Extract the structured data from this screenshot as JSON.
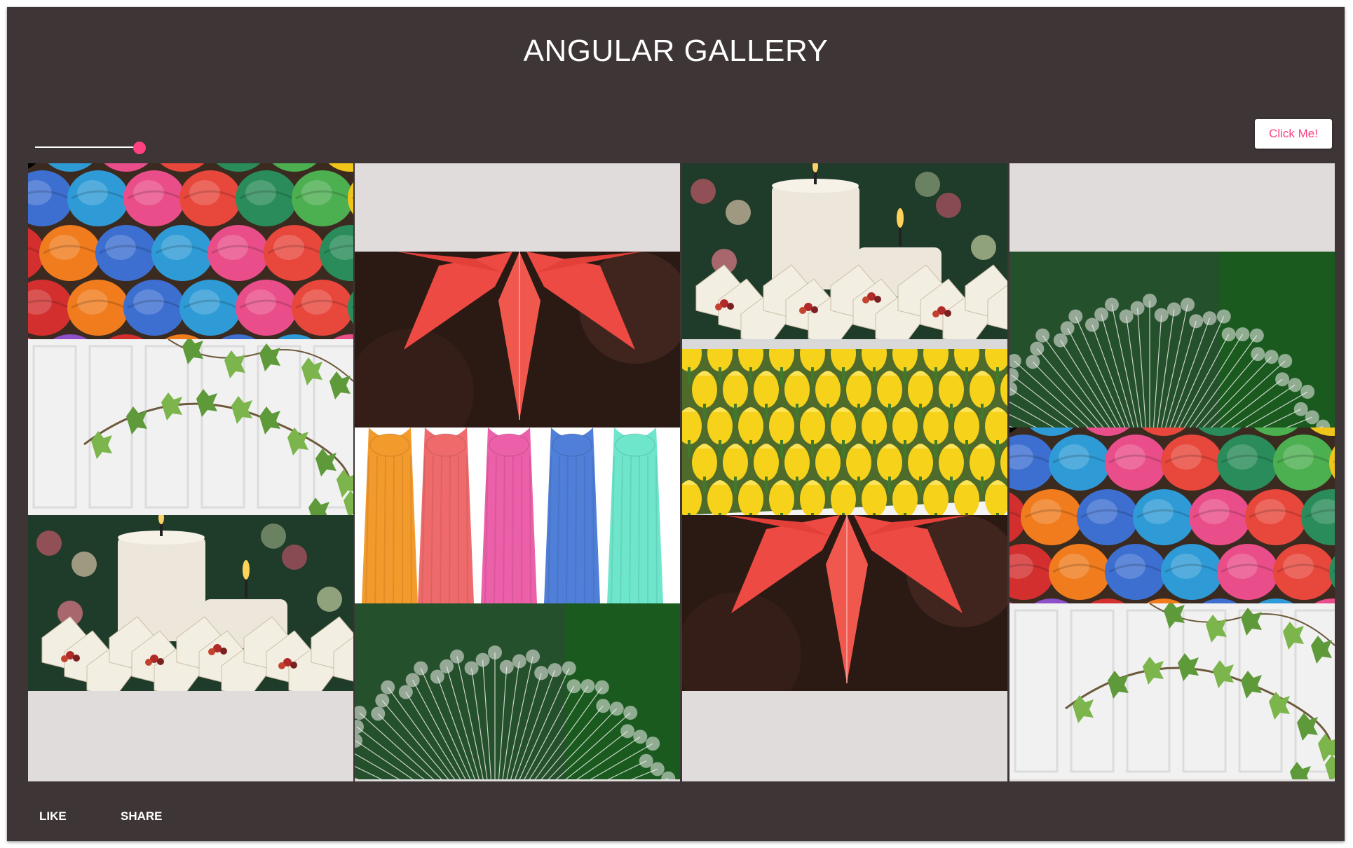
{
  "header": {
    "title": "ANGULAR GALLERY"
  },
  "controls": {
    "slider_value_percent": 100,
    "click_button_label": "Click Me!"
  },
  "colors": {
    "card_bg": "#3d3536",
    "accent": "#ff4081",
    "grid_bg": "#e0dcdc"
  },
  "gallery": {
    "columns": [
      {
        "tiles": [
          "yarn",
          "ivy",
          "candles"
        ]
      },
      {
        "tiles": [
          "red-leaf",
          "scarves",
          "dandelion"
        ]
      },
      {
        "tiles": [
          "candles",
          "yellow-tulips",
          "red-leaf"
        ]
      },
      {
        "tiles": [
          "dandelion",
          "yarn",
          "ivy"
        ]
      }
    ]
  },
  "actions": {
    "like_label": "LIKE",
    "share_label": "SHARE"
  }
}
